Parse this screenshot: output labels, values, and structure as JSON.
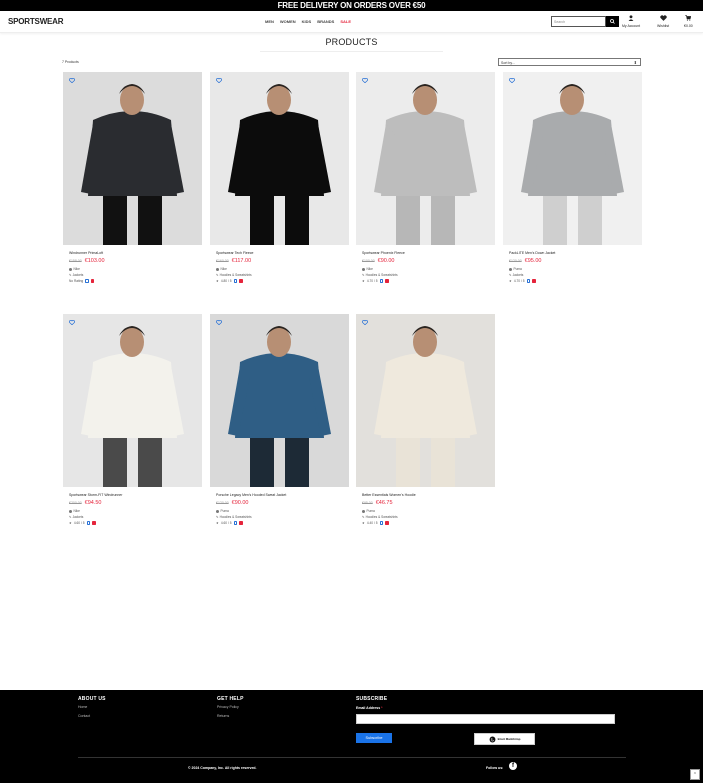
{
  "topbar": {
    "text": "FREE DELIVERY ON ORDERS OVER €50"
  },
  "header": {
    "logo": "SPORTSWEAR",
    "nav": [
      "MEN",
      "WOMEN",
      "KIDS",
      "BRANDS",
      "SALE"
    ],
    "search_placeholder": "Search",
    "account_label": "My Account",
    "wishlist_label": "Wishlist",
    "cart_total": "€0.00"
  },
  "page": {
    "title": "PRODUCTS",
    "count": "7 Products",
    "sort_value": "Sort by..."
  },
  "products": [
    {
      "name": "Windrunner PrimaLoft",
      "old_price": "€158.00",
      "price": "€103.00",
      "brand": "Nike",
      "category": "Jackets",
      "rating": "No Rating",
      "colors": {
        "bg": "#dcdcdc",
        "main": "#2a2c30",
        "pants": "#111111"
      }
    },
    {
      "name": "Sportswear Tech Fleece",
      "old_price": "€160.00",
      "price": "€117.00",
      "brand": "Nike",
      "category": "Hoodies & Sweatshirts",
      "rating": "4.80 / 5",
      "colors": {
        "bg": "#e8e8e8",
        "main": "#0c0c0c",
        "pants": "#0c0c0c"
      }
    },
    {
      "name": "Sportswear Phoenix Fleece",
      "old_price": "€100.00",
      "price": "€90.00",
      "brand": "Nike",
      "category": "Hoodies & Sweatshirts",
      "rating": "4.70 / 5",
      "colors": {
        "bg": "#ececec",
        "main": "#bdbdbd",
        "pants": "#b7b7b7"
      }
    },
    {
      "name": "PackLITE Men's Down Jacket",
      "old_price": "€120.00",
      "price": "€95.00",
      "brand": "Puma",
      "category": "Jackets",
      "rating": "4.70 / 5",
      "colors": {
        "bg": "#f0f0f0",
        "main": "#a9abad",
        "pants": "#cfcfcf"
      }
    },
    {
      "name": "Sportswear Storm-FIT Windrunner",
      "old_price": "€200.00",
      "price": "€94.50",
      "brand": "Nike",
      "category": "Jackets",
      "rating": "4.60 / 5",
      "colors": {
        "bg": "#e6e6e6",
        "main": "#f3f2ec",
        "pants": "#4a4a4a"
      }
    },
    {
      "name": "Porsche Legacy Men's Hooded Sweat Jacket",
      "old_price": "€120.00",
      "price": "€90.00",
      "brand": "Puma",
      "category": "Hoodies & Sweatshirts",
      "rating": "4.60 / 5",
      "colors": {
        "bg": "#d9d9d9",
        "main": "#2f5e85",
        "pants": "#1d2a36"
      }
    },
    {
      "name": "Better Essentials Women's Hoodie",
      "old_price": "€95.00",
      "price": "€46.75",
      "brand": "Puma",
      "category": "Hoodies & Sweatshirts",
      "rating": "4.40 / 5",
      "colors": {
        "bg": "#e2e0dc",
        "main": "#efe9dd",
        "pants": "#e9e3d7"
      }
    }
  ],
  "footer": {
    "about_title": "ABOUT US",
    "about_links": [
      "Home",
      "Contact"
    ],
    "help_title": "GET HELP",
    "help_links": [
      "Privacy Policy",
      "Returns"
    ],
    "subscribe_title": "SUBSCRIBE",
    "email_label": "Email Address",
    "email_required": "*",
    "subscribe_button": "Subscribe",
    "badge_text": "Intuit Mailchimp",
    "copyright": "© 2024 Company, Inc. All rights reserved.",
    "follow_label": "Follow us:"
  },
  "colors": {
    "accent": "#e5243b",
    "link_blue": "#1a73e8",
    "black": "#000000"
  }
}
